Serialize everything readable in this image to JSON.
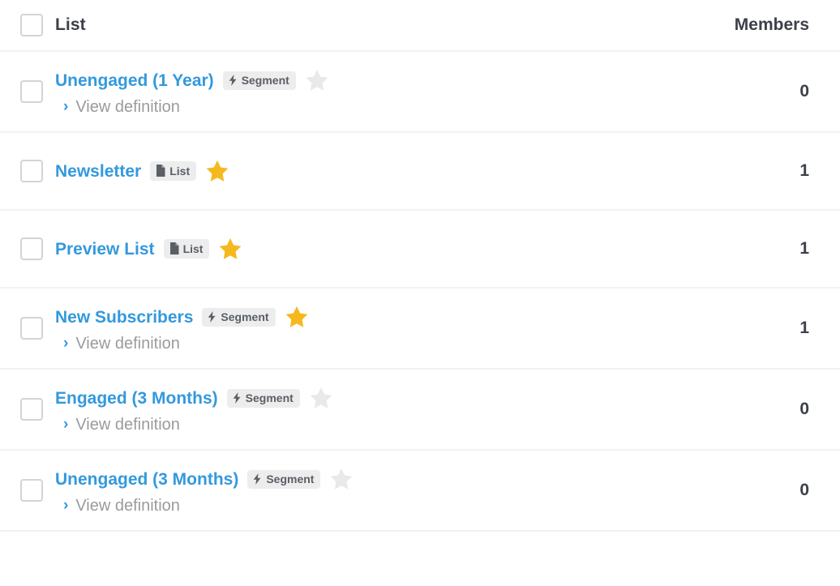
{
  "table": {
    "columns": {
      "select_all": "select-all-checkbox",
      "list": "List",
      "members": "Members"
    },
    "view_definition_label": "View definition",
    "badges": {
      "segment": "Segment",
      "list": "List"
    },
    "colors": {
      "link": "#3399dd",
      "star_active": "#f5b81e",
      "star_inactive": "#e9e9e9",
      "badge_bg": "#ededed",
      "badge_text": "#5a5f66",
      "row_divider": "#f2f2f2",
      "text": "#3c4048",
      "muted_text": "#9b9b9b"
    },
    "rows": [
      {
        "name": "Unengaged (1 Year)",
        "type": "Segment",
        "type_icon": "bolt-icon",
        "starred": false,
        "has_definition": true,
        "members": "0"
      },
      {
        "name": "Newsletter",
        "type": "List",
        "type_icon": "document-icon",
        "starred": true,
        "has_definition": false,
        "members": "1"
      },
      {
        "name": "Preview List",
        "type": "List",
        "type_icon": "document-icon",
        "starred": true,
        "has_definition": false,
        "members": "1"
      },
      {
        "name": "New Subscribers",
        "type": "Segment",
        "type_icon": "bolt-icon",
        "starred": true,
        "has_definition": true,
        "members": "1"
      },
      {
        "name": "Engaged (3 Months)",
        "type": "Segment",
        "type_icon": "bolt-icon",
        "starred": false,
        "has_definition": true,
        "members": "0"
      },
      {
        "name": "Unengaged (3 Months)",
        "type": "Segment",
        "type_icon": "bolt-icon",
        "starred": false,
        "has_definition": true,
        "members": "0"
      }
    ]
  }
}
